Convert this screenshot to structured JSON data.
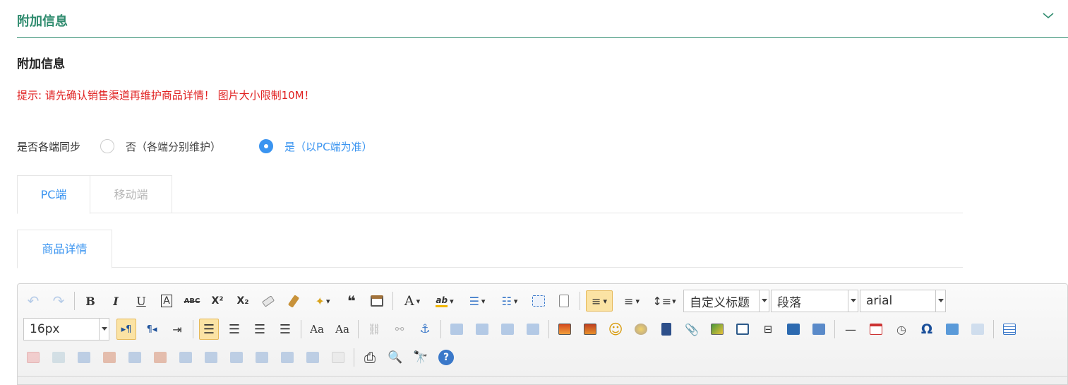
{
  "section": {
    "title": "附加信息"
  },
  "subtitle": "附加信息",
  "tip": "提示: 请先确认销售渠道再维护商品详情！ 图片大小限制10M！",
  "sync": {
    "label": "是否各端同步",
    "options": [
      {
        "label": "否（各端分别维护）",
        "checked": false
      },
      {
        "label": "是（以PC端为准）",
        "checked": true
      }
    ]
  },
  "platform_tabs": [
    {
      "label": "PC端",
      "active": true
    },
    {
      "label": "移动端",
      "active": false
    }
  ],
  "content_tabs": [
    {
      "label": "商品详情",
      "active": true
    }
  ],
  "editor": {
    "glyphs": {
      "undo": "↶",
      "redo": "↷",
      "bold": "B",
      "italic": "I",
      "underline": "U",
      "fontborder": "A",
      "strike": "ABC",
      "sup": "X²",
      "sub": "X₂",
      "quote": "❝",
      "fontcolor": "A",
      "dropdown": "▾",
      "removeformat": "⌫",
      "ltr": "▸¶",
      "rtl": "¶◂",
      "anchor": "⚓",
      "emoji": "☺",
      "omega": "Ω",
      "help": "?",
      "hr": "—",
      "print": "⎙"
    },
    "custom_heading": "自定义标题",
    "paragraph": "段落",
    "font_family": "arial",
    "font_size": "16px"
  }
}
